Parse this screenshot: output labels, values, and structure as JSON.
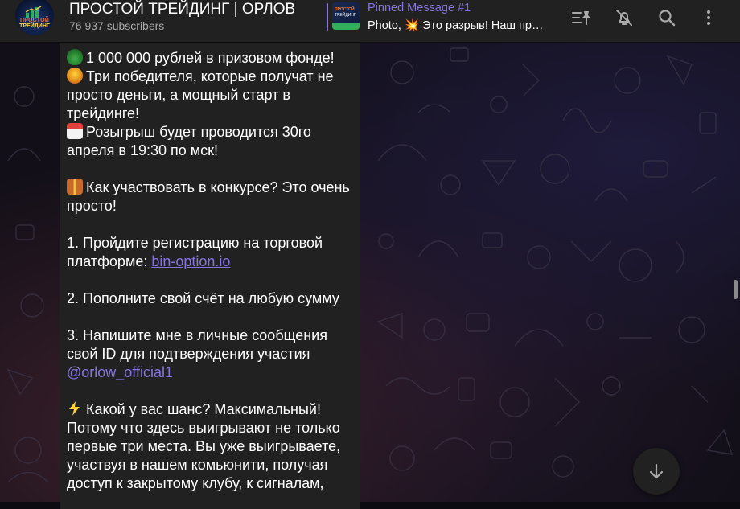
{
  "channel": {
    "title": "ПРОСТОЙ ТРЕЙДИНГ | ОРЛОВ",
    "subscribers": "76 937 subscribers",
    "avatar_text_top": "ПРОСТОЙ",
    "avatar_text_bottom": "ТРЕЙДИНГ"
  },
  "pinned": {
    "title": "Pinned Message #1",
    "text": "Photo, 💥 Это разрыв! Наш праздник продолжается",
    "thumb_text_top": "ПРОСТОЙ",
    "thumb_text_bottom": "ТРЕЙДИНГ"
  },
  "header_icons": [
    "pinned-list-icon",
    "mute-bell-icon",
    "search-icon",
    "more-vert-icon"
  ],
  "message": {
    "line_prize": "1 000 000 рублей в призовом фонде!",
    "line_winners": "Три победителя, которые получат не просто деньги, а мощный старт в трейдинге!",
    "line_draw": "Розыгрыш будет проводится 30го апреля в 19:30 по мск!",
    "line_how": "Как участвовать в конкурсе? Это очень просто!",
    "step1_text": "1. Пройдите регистрацию на торговой платформе: ",
    "step1_link": "bin-option.io",
    "step2_text": "2. Пополните свой счёт на любую сумму",
    "step3_text": "3. Напишите мне в личные сообщения свой ID для подтверждения участия",
    "step3_mention": "@orlow_official1",
    "line_chance": "Какой у вас шанс? Максимальный! Потому что здесь выигрывают не только первые три места. Вы уже выигрываете, участвуя в нашем комьюнити, получая доступ к закрытому клубу, к сигналам,",
    "emoji": {
      "money_bag": "money-bag-icon",
      "medal": "medal-icon",
      "calendar": "calendar-icon",
      "gift_box": "gift-icon",
      "lightning": "lightning-icon"
    }
  },
  "colors": {
    "header_bg": "#212121",
    "accent": "#8774e1",
    "bubble_bg": "#212121",
    "text": "#ffffff",
    "muted": "#aaaaaa"
  }
}
